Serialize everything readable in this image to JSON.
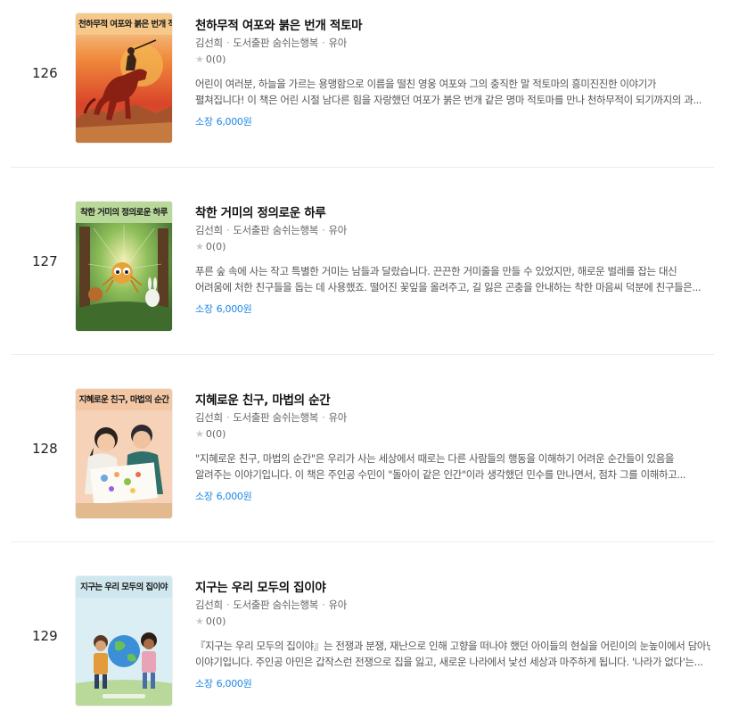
{
  "books": [
    {
      "rank": "126",
      "title": "천하무적 여포와 붉은 번개 적토마",
      "cover_title": "천하무적 여포와 붉은 번개 적토마",
      "author": "김선희",
      "publisher": "도서출판 숨쉬는행복",
      "category": "유아",
      "rating": "0(0)",
      "desc_line1": "어린이 여러분, 하늘을 가르는 용맹함으로 이름을 떨친 영웅 여포와 그의 충직한 말 적토마의 흥미진진한 이야기가",
      "desc_line2": "펼쳐집니다! 이 책은 어린 시절 남다른 힘을 자랑했던 여포가 붉은 번개 같은 명마 적토마를 만나 천하무적이 되기까지의 과...",
      "price_label": "소장",
      "price": "6,000원"
    },
    {
      "rank": "127",
      "title": "착한 거미의 정의로운 하루",
      "cover_title": "착한 거미의 정의로운 하루",
      "author": "김선희",
      "publisher": "도서출판 숨쉬는행복",
      "category": "유아",
      "rating": "0(0)",
      "desc_line1": "푸른 숲 속에 사는 작고 특별한 거미는 남들과 달랐습니다. 끈끈한 거미줄을 만들 수 있었지만, 해로운 벌레를 잡는 대신",
      "desc_line2": "어려움에 처한 친구들을 돕는 데 사용했죠. 떨어진 꽃잎을 올려주고, 길 잃은 곤충을 안내하는 착한 마음씨 덕분에 친구들은...",
      "price_label": "소장",
      "price": "6,000원"
    },
    {
      "rank": "128",
      "title": "지혜로운 친구, 마법의 순간",
      "cover_title": "지혜로운 친구, 마법의 순간",
      "author": "김선희",
      "publisher": "도서출판 숨쉬는행복",
      "category": "유아",
      "rating": "0(0)",
      "desc_line1": "\"지혜로운 친구, 마법의 순간\"은 우리가 사는 세상에서 때로는 다른 사람들의 행동을 이해하기 어려운 순간들이 있음을",
      "desc_line2": "알려주는 이야기입니다. 이 책은 주인공 수민이 \"돌아이 같은 인간\"이라 생각했던 민수를 만나면서, 점차 그를 이해하고...",
      "price_label": "소장",
      "price": "6,000원"
    },
    {
      "rank": "129",
      "title": "지구는 우리 모두의 집이야",
      "cover_title": "지구는 우리 모두의 집이야",
      "author": "김선희",
      "publisher": "도서출판 숨쉬는행복",
      "category": "유아",
      "rating": "0(0)",
      "desc_line1": "『지구는 우리 모두의 집이야』는 전쟁과 분쟁, 재난으로 인해 고향을 떠나야 했던 아이들의 현실을 어린이의 눈높이에서 담아낸",
      "desc_line2": "이야기입니다. 주인공 아민은 갑작스런 전쟁으로 집을 잃고, 새로운 나라에서 낯선 세상과 마주하게 됩니다. '나라가 없다'는...",
      "price_label": "소장",
      "price": "6,000원"
    }
  ],
  "colors": {
    "price": "#1e88e5",
    "separator": "#ececec",
    "star": "#c8c8c8"
  },
  "icons": {
    "rating": "star-icon"
  }
}
